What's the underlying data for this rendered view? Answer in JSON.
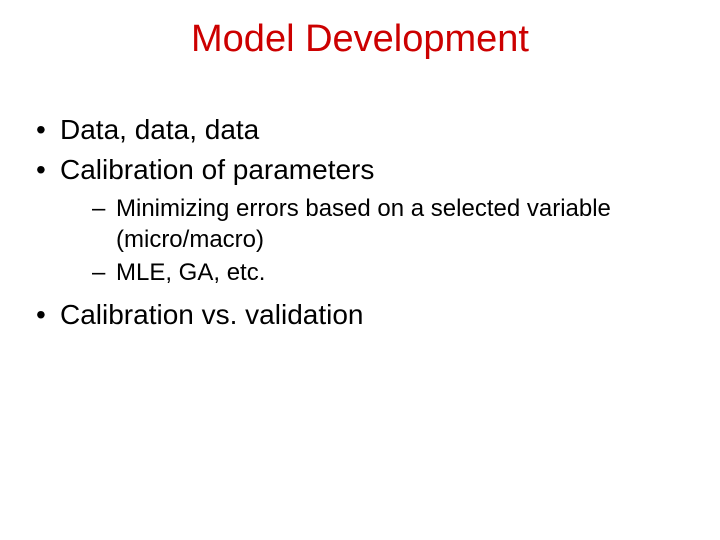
{
  "title": "Model Development",
  "bullets": {
    "b1": "Data, data, data",
    "b2": "Calibration of parameters",
    "b2_sub": {
      "s1": "Minimizing errors based on a selected variable (micro/macro)",
      "s2": "MLE, GA, etc."
    },
    "b3": "Calibration vs. validation"
  }
}
